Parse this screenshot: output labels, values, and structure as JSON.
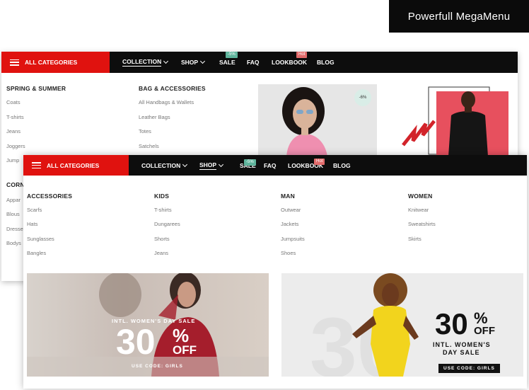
{
  "header_badge": "Powerfull MegaMenu",
  "back_menu": {
    "all_categories": "ALL CATEGORIES",
    "nav": [
      {
        "label": "COLLECTION",
        "has_dropdown": true,
        "active": true
      },
      {
        "label": "SHOP",
        "has_dropdown": true,
        "active": false
      },
      {
        "label": "SALE",
        "has_dropdown": false,
        "active": false,
        "tag": "-5%"
      },
      {
        "label": "FAQ",
        "has_dropdown": false,
        "active": false
      },
      {
        "label": "LOOKBOOK",
        "has_dropdown": false,
        "active": false,
        "tag": "Hot"
      },
      {
        "label": "BLOG",
        "has_dropdown": false,
        "active": false
      }
    ],
    "columns": [
      {
        "title": "SPRING & SUMMER",
        "items": [
          "Coats",
          "T-shirts",
          "Jeans",
          "Joggers",
          "Jump"
        ]
      },
      {
        "title": "BAG & ACCESSORIES",
        "items": [
          "All Handbags & Wallets",
          "Leather Bags",
          "Totes",
          "Satchels"
        ]
      },
      {
        "title": "CORN",
        "items": [
          "Appar",
          "Blous",
          "Dresse",
          "Bodys"
        ]
      }
    ],
    "product_discount": "-6%"
  },
  "front_menu": {
    "all_categories": "ALL CATEGORIES",
    "nav": [
      {
        "label": "COLLECTION",
        "has_dropdown": true,
        "active": false
      },
      {
        "label": "SHOP",
        "has_dropdown": true,
        "active": true
      },
      {
        "label": "SALE",
        "has_dropdown": false,
        "active": false,
        "tag": "-5%"
      },
      {
        "label": "FAQ",
        "has_dropdown": false,
        "active": false
      },
      {
        "label": "LOOKBOOK",
        "has_dropdown": false,
        "active": false,
        "tag": "Hot"
      },
      {
        "label": "BLOG",
        "has_dropdown": false,
        "active": false
      }
    ],
    "columns": [
      {
        "title": "ACCESSORIES",
        "items": [
          "Scarfs",
          "Hats",
          "Sunglasses",
          "Bangles"
        ]
      },
      {
        "title": "KIDS",
        "items": [
          "T-shirts",
          "Dungarees",
          "Shorts",
          "Jeans"
        ]
      },
      {
        "title": "MAN",
        "items": [
          "Outwear",
          "Jackets",
          "Jumpsuits",
          "Shoes"
        ]
      },
      {
        "title": "WOMEN",
        "items": [
          "Knitwear",
          "Sweatshirts",
          "Skirts"
        ]
      }
    ],
    "banner_left": {
      "line1": "INTL. WOMEN'S DAY SALE",
      "big": "30",
      "percent": "%",
      "off": "OFF",
      "code": "USE CODE: GIRLS"
    },
    "banner_right": {
      "big": "30",
      "percent": "%",
      "off": "OFF",
      "line1": "INTL. WOMEN'S",
      "line2": "DAY SALE",
      "code": "USE CODE: GIRLS"
    }
  }
}
